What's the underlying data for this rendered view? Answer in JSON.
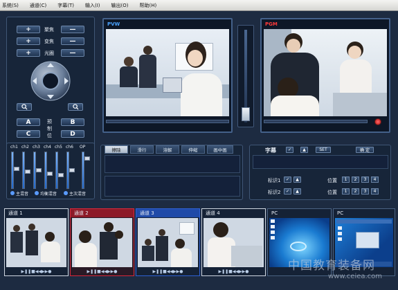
{
  "menu": [
    "系统(S)",
    "通道(C)",
    "字幕(T)",
    "输入(I)",
    "输出(O)",
    "帮助(H)"
  ],
  "camera": {
    "focus_label": "聚焦",
    "zoom_label": "变焦",
    "iris_label": "光圈",
    "plus": "+",
    "minus": "—",
    "preset_a": "A",
    "preset_b": "B",
    "preset_c": "C",
    "preset_d": "D",
    "preset_label": [
      "预",
      "制",
      "位"
    ]
  },
  "monitors": {
    "preview_label": "PVW",
    "program_label": "PGM"
  },
  "audio": {
    "channels": [
      "ch1",
      "ch2",
      "ch3",
      "ch4",
      "ch5",
      "ch6",
      "OP"
    ],
    "master_label": "主混音",
    "balance_label": "均衡混音",
    "aux_label": "主次混音",
    "levels": [
      0.55,
      0.45,
      0.5,
      0.4,
      0.35,
      0.5,
      0.85
    ]
  },
  "transitions": {
    "tabs": [
      "擦除",
      "滑行",
      "溶解",
      "伸缩",
      "画中画"
    ]
  },
  "subtitle": {
    "title": "字幕",
    "set_label": "SET",
    "confirm_label": "确 定",
    "marker1_label": "标识1",
    "marker2_label": "标识2",
    "position_label": "位置",
    "positions": [
      "1",
      "2",
      "3",
      "4"
    ]
  },
  "thumbnails": [
    {
      "label": "通道 1",
      "border": "#cfd7e2"
    },
    {
      "label": "通道 2",
      "border": "#d8283a"
    },
    {
      "label": "通道 3",
      "border": "#2f62d6"
    },
    {
      "label": "通道 4",
      "border": "#cfd7e2"
    },
    {
      "label": "PC",
      "border": "#cfd7e2"
    },
    {
      "label": "PC",
      "border": "#cfd7e2"
    }
  ],
  "watermark": {
    "text": "中国教育装备网",
    "url": "www.ceiea.com"
  },
  "colors": {
    "accent_blue": "#2f62d6",
    "pgm_red": "#ff3a3a",
    "pvw_blue": "#4aa3ff"
  }
}
